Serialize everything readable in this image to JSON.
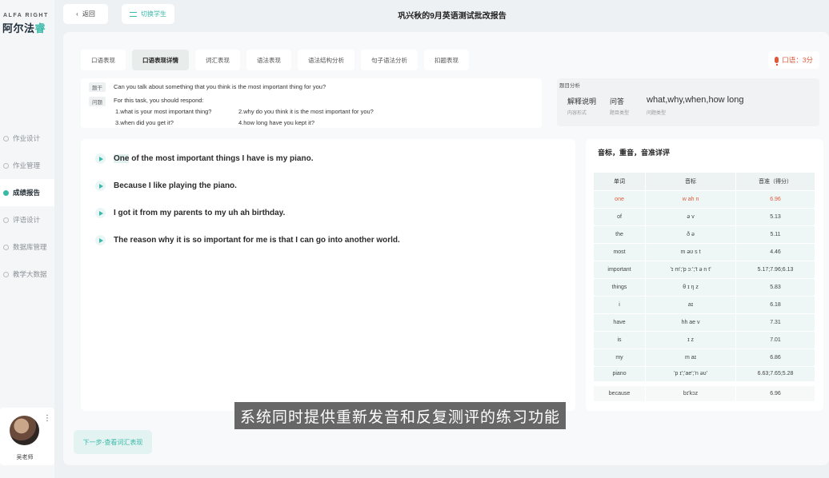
{
  "brand": {
    "en": "ALFA RIGHT",
    "cn_part1": "阿尔法",
    "cn_part2": "睿"
  },
  "nav": [
    {
      "label": "作业设计",
      "active": false
    },
    {
      "label": "作业管理",
      "active": false
    },
    {
      "label": "成绩报告",
      "active": true
    },
    {
      "label": "评语设计",
      "active": false
    },
    {
      "label": "数据库管理",
      "active": false
    },
    {
      "label": "教学大数据",
      "active": false
    }
  ],
  "user": {
    "name": "吴老师"
  },
  "topbar": {
    "back_label": "返回",
    "switch_label": "切换学生",
    "title": "巩兴秋的9月英语测试批改报告"
  },
  "tabs": [
    "口语表现",
    "口语表现详情",
    "词汇表现",
    "语法表现",
    "语法结构分析",
    "句子语法分析",
    "扣题表现"
  ],
  "score": {
    "text": "口语：3分"
  },
  "question": {
    "stem_tag": "题干",
    "stem": "Can you talk about something that you think is the most important thing for you?",
    "prompt_tag": "问题",
    "intro": "For this task, you should respond:",
    "items": [
      "1.what is your most important thing?",
      "2.why do you think it is the most  important for you?",
      "3.when did you get it?",
      "4.how long have you kept it?"
    ]
  },
  "analysis": {
    "title": "题目分析",
    "content_form": "解释说明",
    "content_form_label": "内容形式",
    "type": "问答",
    "type_label": "题目类型",
    "qtypes": "what,why,when,how long",
    "qtypes_label": "问题类型"
  },
  "sentences": [
    {
      "first": "One",
      "rest": " of the most important things I have is my piano."
    },
    {
      "first": "",
      "rest": "Because I like playing the piano."
    },
    {
      "first": "",
      "rest": "I got it from my parents to my uh ah birthday."
    },
    {
      "first": "",
      "rest": "The reason why it is so important for me is that I can go into another world."
    }
  ],
  "pron": {
    "title": "音标，重音，音准详评",
    "headers": [
      "单词",
      "音标",
      "音准（得分）"
    ],
    "rows": [
      {
        "word": "one",
        "ipa": "w ah n",
        "score": "6.96",
        "bad": true
      },
      {
        "word": "of",
        "ipa": "ə v",
        "score": "5.13",
        "bad": false
      },
      {
        "word": "the",
        "ipa": "ð ə",
        "score": "5.11",
        "bad": false
      },
      {
        "word": "most",
        "ipa": "m əʊ s t",
        "score": "4.46",
        "bad": false
      },
      {
        "word": "important",
        "ipa": "'ɪ m';'p ɔː';'t ə n t'",
        "score": "5.17;7.96;6.13",
        "bad": false
      },
      {
        "word": "things",
        "ipa": "θ ɪ ŋ z",
        "score": "5.83",
        "bad": false
      },
      {
        "word": "i",
        "ipa": "aɪ",
        "score": "6.18",
        "bad": false
      },
      {
        "word": "have",
        "ipa": "hh ae v",
        "score": "7.31",
        "bad": false
      },
      {
        "word": "is",
        "ipa": "ɪ z",
        "score": "7.01",
        "bad": false
      },
      {
        "word": "my",
        "ipa": "m aɪ",
        "score": "6.86",
        "bad": false
      },
      {
        "word": "piano",
        "ipa": "'p ɪ';'ae';'n əʊ'",
        "score": "6.63;7.65;5.28",
        "bad": false
      },
      {
        "word": "because",
        "ipa": "bɪ'kɔz",
        "score": "6.96",
        "bad": false
      }
    ]
  },
  "next_label": "下一步-查看词汇表现",
  "subtitle": "系统同时提供重新发音和反复测评的练习功能"
}
